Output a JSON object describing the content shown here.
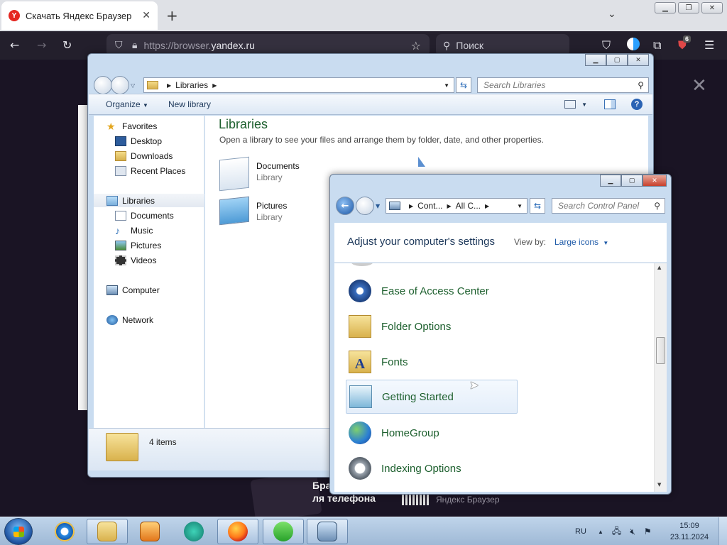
{
  "browser": {
    "tab_title": "Скачать Яндекс Браузер",
    "tab_favicon": "Y",
    "tab_close": "✕",
    "new_tab": "+",
    "tabs_dropdown": "⌄",
    "url_prefix": "https://browser.",
    "url_domain": "yandex.ru",
    "search_placeholder": "Поиск",
    "extension_badge": "6"
  },
  "page": {
    "promo_text": "ля телефона",
    "promo_brand": "Яндекс Браузер",
    "promo_partial": "Бра",
    "close_glyph": "✕"
  },
  "libraries": {
    "breadcrumb": "Libraries",
    "search_placeholder": "Search Libraries",
    "organize": "Organize",
    "new_library": "New library",
    "nav": {
      "favorites": "Favorites",
      "desktop": "Desktop",
      "downloads": "Downloads",
      "recent_places": "Recent Places",
      "libraries": "Libraries",
      "documents": "Documents",
      "music": "Music",
      "pictures": "Pictures",
      "videos": "Videos",
      "computer": "Computer",
      "network": "Network"
    },
    "heading": "Libraries",
    "description": "Open a library to see your files and arrange them by folder, date, and other properties.",
    "items": [
      {
        "name": "Documents",
        "type": "Library"
      },
      {
        "name": "Pictures",
        "type": "Library"
      }
    ],
    "status": "4 items"
  },
  "control_panel": {
    "breadcrumb_1": "Cont...",
    "breadcrumb_2": "All C...",
    "search_placeholder": "Search Control Panel",
    "heading": "Adjust your computer's settings",
    "view_by_label": "View by:",
    "view_by_value": "Large icons",
    "items": [
      {
        "label": "Ease of Access Center"
      },
      {
        "label": "Folder Options"
      },
      {
        "label": "Fonts"
      },
      {
        "label": "Getting Started"
      },
      {
        "label": "HomeGroup"
      },
      {
        "label": "Indexing Options"
      }
    ]
  },
  "taskbar": {
    "language": "RU",
    "time": "15:09",
    "date": "23.11.2024"
  },
  "colors": {
    "accent_green": "#1c5f2d",
    "win_frame": "#c9dcf0",
    "browser_dark": "#231f2c"
  }
}
